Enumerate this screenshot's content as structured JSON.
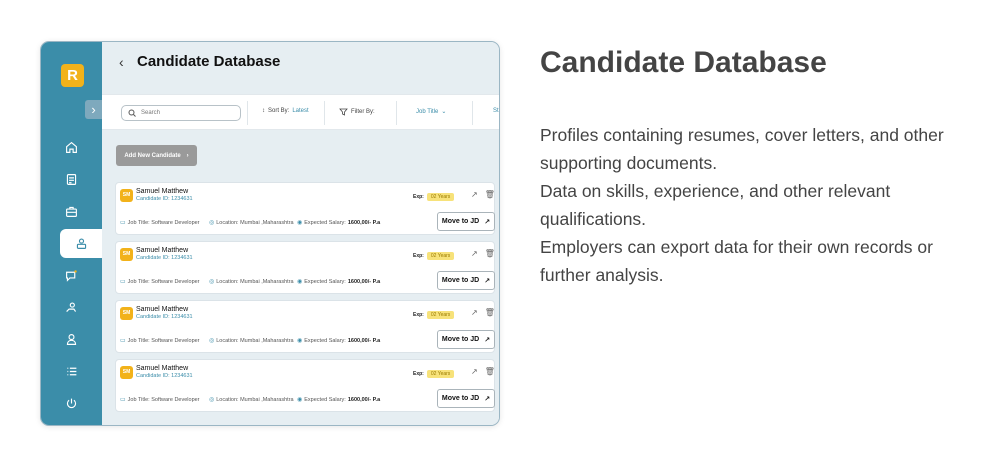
{
  "app": {
    "logo_letter": "R",
    "page_title": "Candidate Database"
  },
  "sidebar": {
    "items": [
      {
        "icon": "home-icon"
      },
      {
        "icon": "document-icon"
      },
      {
        "icon": "briefcase-icon"
      },
      {
        "icon": "candidates-icon",
        "active": true
      },
      {
        "icon": "messages-icon"
      },
      {
        "icon": "interview-icon"
      },
      {
        "icon": "user-icon"
      },
      {
        "icon": "list-icon"
      },
      {
        "icon": "power-icon"
      }
    ]
  },
  "filters": {
    "search_placeholder": "Search",
    "sort_label": "Sort By:",
    "sort_value": "Latest",
    "filter_label": "Filter By:",
    "job_title_label": "Job Title",
    "more_label": "St"
  },
  "actions": {
    "add_new_candidate": "Add New Candidate"
  },
  "candidates": [
    {
      "initials": "SM",
      "name": "Samuel Matthew",
      "id": "Candidate ID: 1234631",
      "exp_label": "Exp:",
      "exp_value": "02 Years",
      "job_title": "Job Title: Software Developer",
      "location": "Location: Mumbai ,Maharashtra",
      "salary_label": "Expected Salary:",
      "salary_value": "1600,00/- P.a",
      "move_label": "Move to JD"
    },
    {
      "initials": "SM",
      "name": "Samuel Matthew",
      "id": "Candidate ID: 1234631",
      "exp_label": "Exp:",
      "exp_value": "02 Years",
      "job_title": "Job Title: Software Developer",
      "location": "Location: Mumbai ,Maharashtra",
      "salary_label": "Expected Salary:",
      "salary_value": "1600,00/- P.a",
      "move_label": "Move to JD"
    },
    {
      "initials": "SM",
      "name": "Samuel Matthew",
      "id": "Candidate ID: 1234631",
      "exp_label": "Exp:",
      "exp_value": "02 Years",
      "job_title": "Job Title: Software Developer",
      "location": "Location: Mumbai ,Maharashtra",
      "salary_label": "Expected Salary:",
      "salary_value": "1600,00/- P.a",
      "move_label": "Move to JD"
    },
    {
      "initials": "SM",
      "name": "Samuel Matthew",
      "id": "Candidate ID: 1234631",
      "exp_label": "Exp:",
      "exp_value": "02 Years",
      "job_title": "Job Title: Software Developer",
      "location": "Location: Mumbai ,Maharashtra",
      "salary_label": "Expected Salary:",
      "salary_value": "1600,00/- P.a",
      "move_label": "Move to JD"
    }
  ],
  "hero": {
    "title": "Candidate Database",
    "lines": [
      "Profiles containing resumes, cover letters, and other supporting documents.",
      "Data on skills, experience, and other relevant qualifications.",
      "Employers can export data for their own records or further analysis."
    ]
  },
  "colors": {
    "sidebar": "#3b8da9",
    "accent": "#f2b21a",
    "background": "#e6eef2"
  }
}
